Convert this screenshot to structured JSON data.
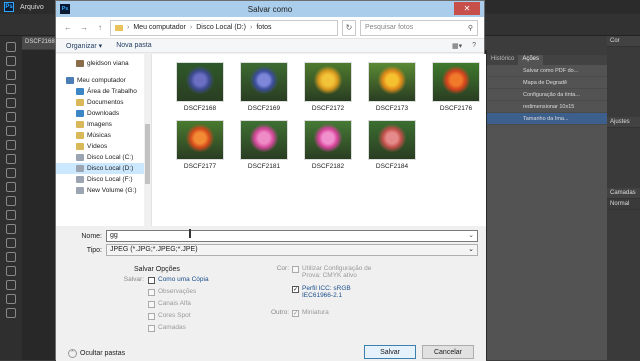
{
  "photoshop": {
    "menu_file": "Arquivo",
    "doc_tab": "DSCF2168",
    "actions_tabs": [
      "Histórico",
      "Ações"
    ],
    "actions_items": [
      "Salvar como PDF do...",
      "Mapa de Degradê",
      "Configuração da tinta...",
      "redimensionar 10x15",
      "Tamanho da Ima..."
    ],
    "actions_selected_index": 4,
    "panel_labels": [
      "Cor",
      "Ajustes",
      "Camadas",
      "Normal"
    ]
  },
  "dialog": {
    "title": "Salvar como",
    "close_label": "✕",
    "breadcrumb": [
      "Meu computador",
      "Disco Local (D:)",
      "fotos"
    ],
    "search_placeholder": "Pesquisar fotos",
    "toolbar": {
      "organize": "Organizar ▾",
      "new_folder": "Nova pasta"
    },
    "nav_items": [
      {
        "label": "gleidson viana",
        "icon": "user-icon",
        "indent": 1,
        "selected": false
      },
      {
        "label": "Meu computador",
        "icon": "computer-icon",
        "indent": 0,
        "selected": false
      },
      {
        "label": "Área de Trabalho",
        "icon": "desktop-icon",
        "indent": 1,
        "selected": false
      },
      {
        "label": "Documentos",
        "icon": "documents-icon",
        "indent": 1,
        "selected": false
      },
      {
        "label": "Downloads",
        "icon": "downloads-icon",
        "indent": 1,
        "selected": false
      },
      {
        "label": "Imagens",
        "icon": "pictures-icon",
        "indent": 1,
        "selected": false
      },
      {
        "label": "Músicas",
        "icon": "music-icon",
        "indent": 1,
        "selected": false
      },
      {
        "label": "Vídeos",
        "icon": "videos-icon",
        "indent": 1,
        "selected": false
      },
      {
        "label": "Disco Local (C:)",
        "icon": "drive-icon",
        "indent": 1,
        "selected": false
      },
      {
        "label": "Disco Local (D:)",
        "icon": "drive-icon",
        "indent": 1,
        "selected": true
      },
      {
        "label": "Disco Local (F:)",
        "icon": "drive-icon",
        "indent": 1,
        "selected": false
      },
      {
        "label": "New Volume (G:)",
        "icon": "drive-icon",
        "indent": 1,
        "selected": false
      }
    ],
    "files": [
      {
        "name": "DSCF2168",
        "colors": [
          "#3d4a8f",
          "#6b6fc4",
          "#2f5a2a"
        ]
      },
      {
        "name": "DSCF2169",
        "colors": [
          "#3b4d9a",
          "#7d86d8",
          "#3d6b32"
        ]
      },
      {
        "name": "DSCF2172",
        "colors": [
          "#d99a1e",
          "#f2c43a",
          "#4e7a2e"
        ]
      },
      {
        "name": "DSCF2173",
        "colors": [
          "#e08a1a",
          "#f5c12e",
          "#5a8a34"
        ]
      },
      {
        "name": "DSCF2176",
        "colors": [
          "#d5431e",
          "#f07a2a",
          "#3f7a2e"
        ]
      },
      {
        "name": "DSCF2177",
        "colors": [
          "#d44a1c",
          "#f38a34",
          "#4a7a30"
        ]
      },
      {
        "name": "DSCF2181",
        "colors": [
          "#d4489a",
          "#ee8ac6",
          "#3e7033"
        ]
      },
      {
        "name": "DSCF2182",
        "colors": [
          "#d8449c",
          "#f090cc",
          "#467a36"
        ]
      },
      {
        "name": "DSCF2184",
        "colors": [
          "#c0504a",
          "#e58a8a",
          "#3b6e30"
        ]
      }
    ],
    "form": {
      "name_label": "Nome:",
      "name_value": "gg",
      "type_label": "Tipo:",
      "type_value": "JPEG (*.JPG;*.JPEG;*.JPE)"
    },
    "options": {
      "title": "Salvar Opções",
      "save_label": "Salvar:",
      "save_as_copy": "Como uma Cópia",
      "notes": "Observações",
      "alpha": "Canais Alfa",
      "spot": "Cores Spot",
      "layers": "Camadas",
      "color_label": "Cor:",
      "proof_setup": "Utilizar Configuração de Prova: CMYK ativo",
      "icc_profile": "Perfil ICC: sRGB IEC61966-2.1",
      "other_label": "Outro:",
      "thumbnail": "Miniatura"
    },
    "buttons": {
      "hide_folders": "Ocultar pastas",
      "save": "Salvar",
      "cancel": "Cancelar"
    }
  }
}
